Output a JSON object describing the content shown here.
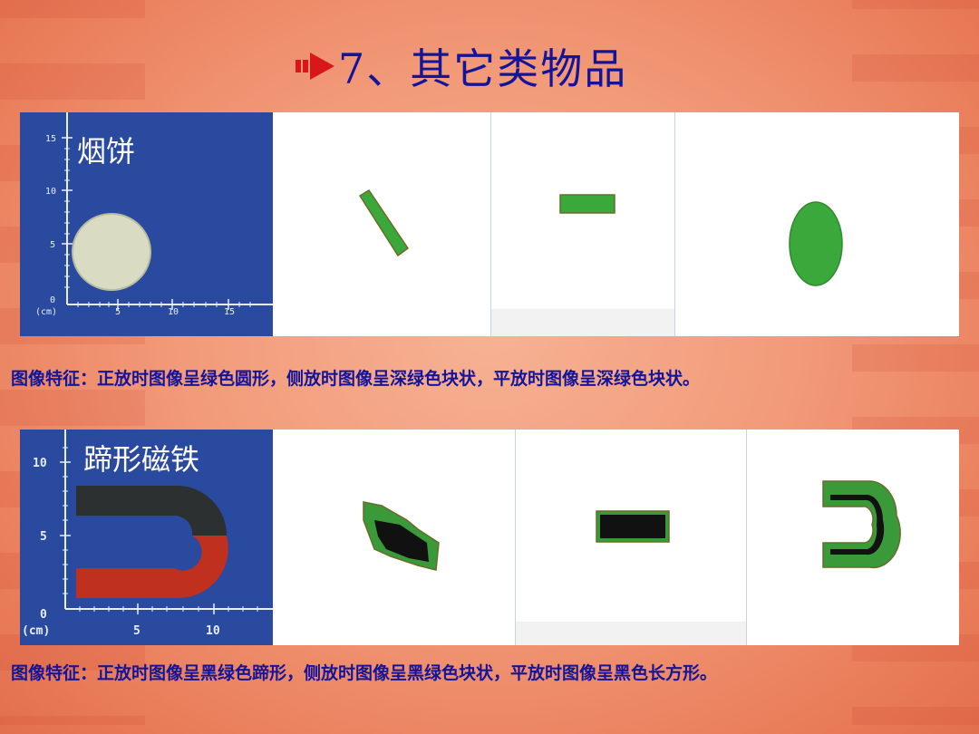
{
  "title": "7、其它类物品",
  "items": [
    {
      "photo_label": "烟饼",
      "axis_ticks": [
        "15",
        "10",
        "5",
        "0",
        "(cm)",
        "5",
        "10",
        "15"
      ],
      "caption": "图像特征：正放时图像呈绿色圆形，侧放时图像呈深绿色块状，平放时图像呈深绿色块状。"
    },
    {
      "photo_label": "蹄形磁铁",
      "axis_ticks": [
        "10",
        "5",
        "0",
        "(cm)",
        "5",
        "10"
      ],
      "caption": "图像特征：正放时图像呈黑绿色蹄形，侧放时图像呈黑绿色块状，平放时图像呈黑色长方形。"
    }
  ],
  "colors": {
    "title": "#14149a",
    "photo_bg": "#2a4aa0",
    "xray_green": "#3aa83a",
    "xray_black": "#111111",
    "magnet_red": "#c0301e"
  }
}
